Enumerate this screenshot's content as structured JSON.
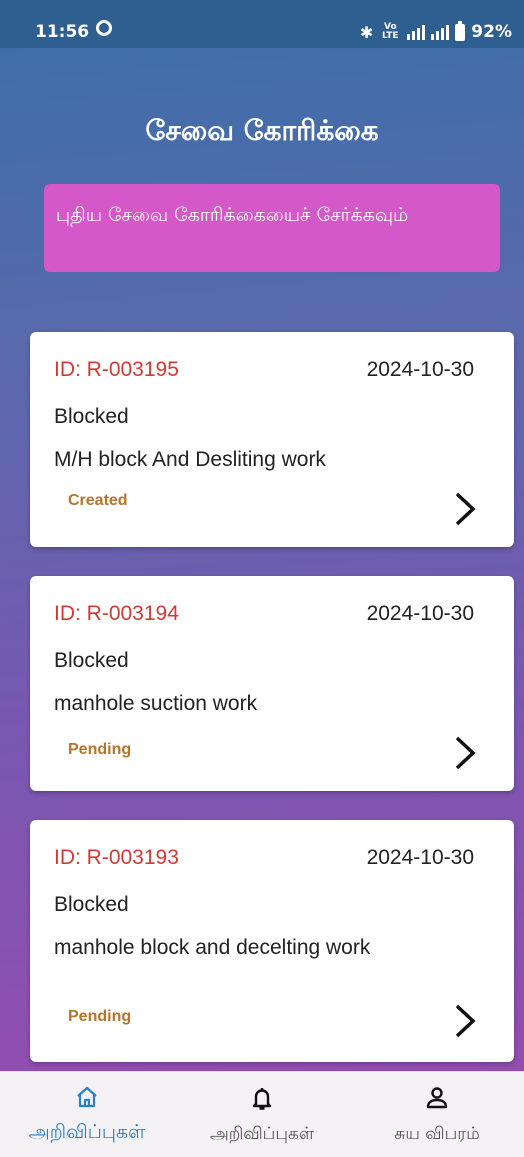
{
  "status_bar": {
    "time": "11:56",
    "volte_label": "Vo B\nLTE",
    "battery": "92%"
  },
  "header": {
    "title": "சேவை கோரிக்கை",
    "add_request_label": "புதிய சேவை கோரிக்கையைச் சேர்க்கவும்"
  },
  "requests": [
    {
      "id": "ID: R-003195",
      "date": "2024-10-30",
      "category": "Blocked",
      "description": "M/H block And Desliting work",
      "status": "Created"
    },
    {
      "id": "ID: R-003194",
      "date": "2024-10-30",
      "category": "Blocked",
      "description": "manhole suction work",
      "status": "Pending"
    },
    {
      "id": "ID: R-003193",
      "date": "2024-10-30",
      "category": "Blocked",
      "description": "manhole block and decelting work",
      "status": "Pending"
    }
  ],
  "bottom_nav": {
    "items": [
      {
        "label": "அறிவிப்புகள்",
        "icon": "home-icon",
        "active": true
      },
      {
        "label": "அறிவிப்புகள்",
        "icon": "bell-icon",
        "active": false
      },
      {
        "label": "சுய விபரம்",
        "icon": "profile-icon",
        "active": false
      }
    ]
  },
  "colors": {
    "id_text": "#d23b33",
    "status_text": "#b7742a",
    "add_button": "#d458c7",
    "nav_active": "#2a7fc7"
  }
}
